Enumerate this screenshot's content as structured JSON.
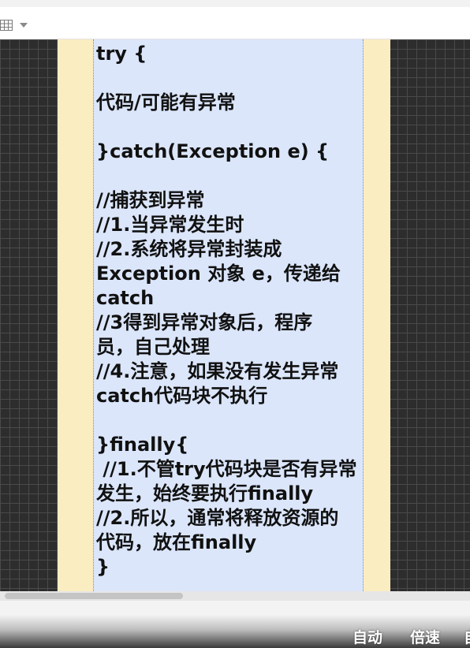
{
  "toolbar": {
    "table_icon": "grid-icon",
    "dropdown_icon": "chevron-down-icon"
  },
  "note": {
    "lines": [
      "try {",
      "",
      "代码/可能有异常",
      "",
      "}catch(Exception e) {",
      "",
      "//捕获到异常",
      "//1.当异常发生时",
      "//2.系统将异常封装成",
      "Exception 对象 e，传递给",
      "catch",
      "//3得到异常对象后，程序",
      "员，自己处理",
      "//4.注意，如果没有发生异常",
      "catch代码块不执行",
      "",
      "}finally{",
      " //1.不管try代码块是否有异常",
      "发生，始终要执行finally",
      "//2.所以，通常将释放资源的",
      "代码，放在finally",
      "}"
    ]
  },
  "player": {
    "auto_label": "自动",
    "speed_label": "倍速",
    "more_label": "自"
  },
  "colors": {
    "note_background": "#dbe6fb",
    "paper_background": "#fbedc2",
    "canvas_background": "#2d2d2d"
  }
}
